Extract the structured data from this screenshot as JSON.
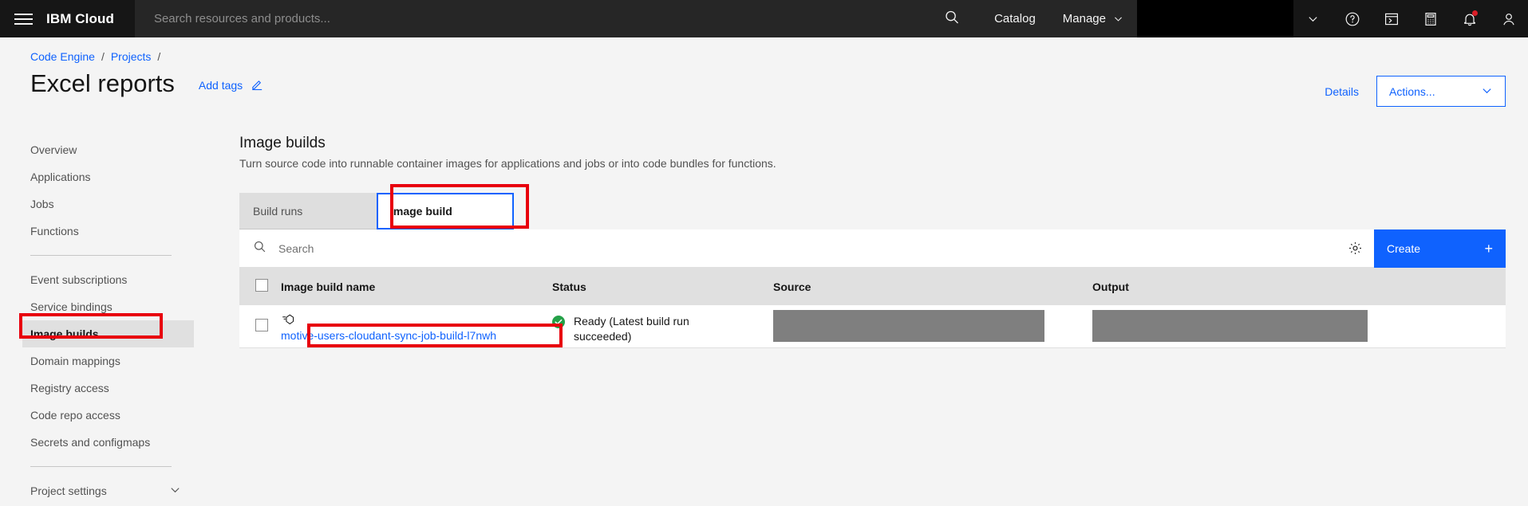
{
  "topnav": {
    "menu_icon": "hamburger-menu-icon",
    "brand": "IBM Cloud",
    "search_placeholder": "Search resources and products...",
    "search_icon": "search-icon",
    "links": [
      {
        "label": "Catalog",
        "has_chevron": false
      },
      {
        "label": "Manage",
        "has_chevron": true
      }
    ],
    "account_redacted": true,
    "icons": [
      "chevron-down-icon",
      "help-question-icon",
      "terminal-console-icon",
      "calculator-cost-icon",
      "notification-bell-icon",
      "user-avatar-icon"
    ],
    "notification_dot_color": "#da1e28"
  },
  "header": {
    "breadcrumb": [
      {
        "label": "Code Engine"
      },
      {
        "label": "Projects"
      }
    ],
    "breadcrumb_separator": "/",
    "title": "Excel reports",
    "add_tags_label": "Add tags",
    "edit_icon": "pencil-edit-icon",
    "details_label": "Details",
    "actions_label": "Actions...",
    "actions_chevron": "chevron-down-icon"
  },
  "sidebar": {
    "groups": [
      {
        "items": [
          {
            "label": "Overview",
            "selected": false
          },
          {
            "label": "Applications",
            "selected": false
          },
          {
            "label": "Jobs",
            "selected": false
          },
          {
            "label": "Functions",
            "selected": false
          }
        ]
      },
      {
        "items": [
          {
            "label": "Event subscriptions",
            "selected": false
          },
          {
            "label": "Service bindings",
            "selected": false
          },
          {
            "label": "Image builds",
            "selected": true
          },
          {
            "label": "Domain mappings",
            "selected": false
          },
          {
            "label": "Registry access",
            "selected": false
          },
          {
            "label": "Code repo access",
            "selected": false
          },
          {
            "label": "Secrets and configmaps",
            "selected": false
          }
        ]
      },
      {
        "items": [
          {
            "label": "Project settings",
            "selected": false,
            "expandable": true
          }
        ]
      }
    ]
  },
  "main": {
    "title": "Image builds",
    "subtitle": "Turn source code into runnable container images for applications and jobs or into code bundles for functions.",
    "tabs": [
      {
        "label": "Build runs",
        "active": false
      },
      {
        "label": "Image build",
        "active": true
      }
    ],
    "toolbar": {
      "search_placeholder": "Search",
      "search_icon": "search-icon",
      "settings_icon": "gear-settings-icon",
      "create_label": "Create",
      "create_plus": "+"
    },
    "table": {
      "columns": [
        "Image build name",
        "Status",
        "Source",
        "Output"
      ],
      "select_all_checkbox": true,
      "rows": [
        {
          "checkbox": false,
          "icon": "image-build-icon",
          "name": "motive-users-cloudant-sync-job-build-l7nwh",
          "status_icon": "status-success-check-icon",
          "status": "Ready (Latest build run succeeded)",
          "source": "",
          "source_redacted": true,
          "output": "",
          "output_redacted": true
        }
      ]
    }
  },
  "annotations": {
    "color": "#e8000d",
    "boxes": [
      {
        "name": "sidebar-image-builds-highlight"
      },
      {
        "name": "image-build-tab-highlight"
      },
      {
        "name": "build-name-link-highlight"
      }
    ]
  },
  "colors": {
    "brand_blue": "#0f62fe",
    "nav_dark": "#161616",
    "nav_search_bg": "#262626",
    "page_bg": "#f4f4f4",
    "table_header_bg": "#e0e0e0",
    "success_green": "#24a148",
    "annotation_red": "#e8000d",
    "redaction_gray": "#7f7f7f"
  }
}
